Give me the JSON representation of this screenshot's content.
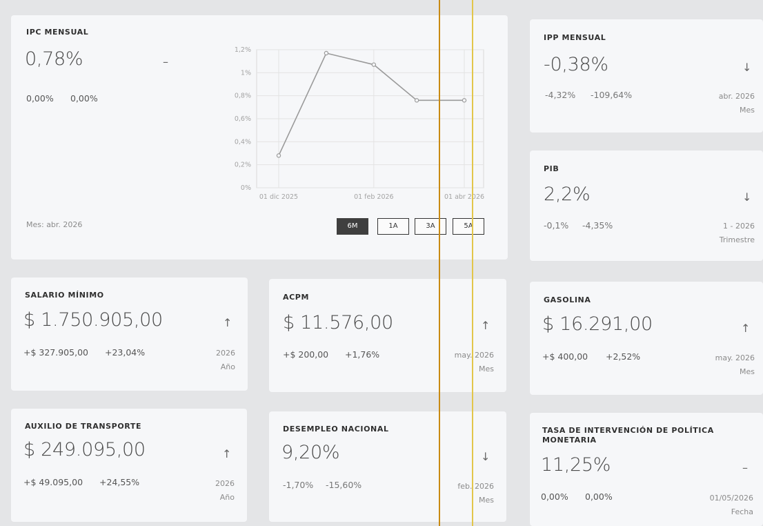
{
  "ipc": {
    "title": "IPC MENSUAL",
    "value": "0,78%",
    "trend_symbol": "–",
    "change_abs": "0,00%",
    "change_pct": "0,00%",
    "footer": "Mes: abr. 2026",
    "ranges": [
      "6M",
      "1A",
      "3A",
      "5A"
    ],
    "active_range": "6M"
  },
  "chart_data": {
    "type": "line",
    "x": [
      "2025-12-01",
      "2026-01-01",
      "2026-02-01",
      "2026-03-01",
      "2026-04-01"
    ],
    "x_tick_labels": [
      "01 dic 2025",
      "01 feb 2026",
      "01 abr 2026"
    ],
    "y_tick_labels": [
      "0%",
      "0,2%",
      "0,4%",
      "0,6%",
      "0,8%",
      "1%",
      "1,2%"
    ],
    "series": [
      {
        "values": [
          0.28,
          1.17,
          1.07,
          0.76,
          0.76
        ]
      }
    ],
    "ylim": [
      0,
      1.2
    ],
    "grid": true,
    "line_color": "#9a9a9a"
  },
  "ipp": {
    "title": "IPP MENSUAL",
    "value": "-0,38%",
    "trend_symbol": "↓",
    "change_abs": "-4,32%",
    "change_pct": "-109,64%",
    "period_value": "abr. 2026",
    "period_unit": "Mes"
  },
  "pib": {
    "title": "PIB",
    "value": "2,2%",
    "trend_symbol": "↓",
    "change_abs": "-0,1%",
    "change_pct": "-4,35%",
    "period_value": "1 - 2026",
    "period_unit": "Trimestre"
  },
  "salario": {
    "title": "SALARIO MÍNIMO",
    "value": "$ 1.750.905,00",
    "trend_symbol": "↑",
    "change_abs": "+$ 327.905,00",
    "change_pct": "+23,04%",
    "period_value": "2026",
    "period_unit": "Año"
  },
  "acpm": {
    "title": "ACPM",
    "value": "$ 11.576,00",
    "trend_symbol": "↑",
    "change_abs": "+$ 200,00",
    "change_pct": "+1,76%",
    "period_value": "may. 2026",
    "period_unit": "Mes"
  },
  "gasolina": {
    "title": "GASOLINA",
    "value": "$ 16.291,00",
    "trend_symbol": "↑",
    "change_abs": "+$ 400,00",
    "change_pct": "+2,52%",
    "period_value": "may. 2026",
    "period_unit": "Mes"
  },
  "auxilio": {
    "title": "AUXILIO DE TRANSPORTE",
    "value": "$ 249.095,00",
    "trend_symbol": "↑",
    "change_abs": "+$ 49.095,00",
    "change_pct": "+24,55%",
    "period_value": "2026",
    "period_unit": "Año"
  },
  "desempleo": {
    "title": "DESEMPLEO NACIONAL",
    "value": "9,20%",
    "trend_symbol": "↓",
    "change_abs": "-1,70%",
    "change_pct": "-15,60%",
    "period_value": "feb. 2026",
    "period_unit": "Mes"
  },
  "tasa": {
    "title": "TASA DE INTERVENCIÓN DE POLÍTICA MONETARIA",
    "value": "11,25%",
    "trend_symbol": "–",
    "change_abs": "0,00%",
    "change_pct": "0,00%",
    "period_value": "01/05/2026",
    "period_unit": "Fecha"
  },
  "colors": {
    "background": "#e4e5e7",
    "card": "#f6f7f9",
    "overlay_line_orange": "#c98a12",
    "overlay_line_yellow": "#e2c64a"
  }
}
